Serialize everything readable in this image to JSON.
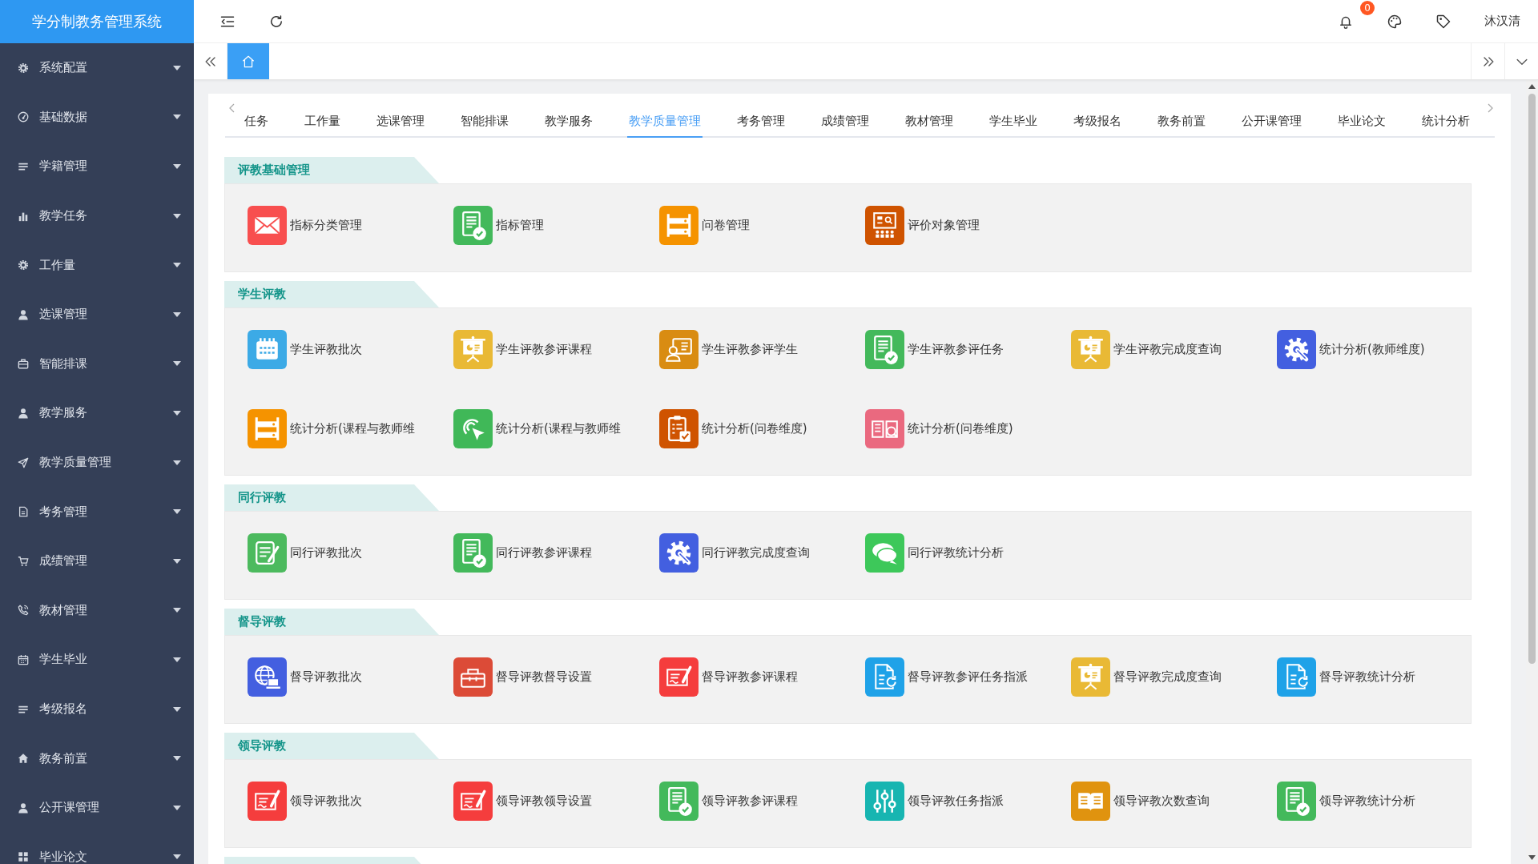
{
  "app": {
    "title": "学分制教务管理系统"
  },
  "sidebar": {
    "items": [
      {
        "label": "系统配置"
      },
      {
        "label": "基础数据"
      },
      {
        "label": "学籍管理"
      },
      {
        "label": "教学任务"
      },
      {
        "label": "工作量"
      },
      {
        "label": "选课管理"
      },
      {
        "label": "智能排课"
      },
      {
        "label": "教学服务"
      },
      {
        "label": "教学质量管理"
      },
      {
        "label": "考务管理"
      },
      {
        "label": "成绩管理"
      },
      {
        "label": "教材管理"
      },
      {
        "label": "学生毕业"
      },
      {
        "label": "考级报名"
      },
      {
        "label": "教务前置"
      },
      {
        "label": "公开课管理"
      },
      {
        "label": "毕业论文"
      }
    ]
  },
  "header": {
    "notification_count": "0",
    "user_name": "沐汉清"
  },
  "page_tabs": [
    {
      "selected": true
    }
  ],
  "content_tabs": [
    {
      "label": "任务",
      "selected": false
    },
    {
      "label": "工作量",
      "selected": false
    },
    {
      "label": "选课管理",
      "selected": false
    },
    {
      "label": "智能排课",
      "selected": false
    },
    {
      "label": "教学服务",
      "selected": false
    },
    {
      "label": "教学质量管理",
      "selected": true
    },
    {
      "label": "考务管理",
      "selected": false
    },
    {
      "label": "成绩管理",
      "selected": false
    },
    {
      "label": "教材管理",
      "selected": false
    },
    {
      "label": "学生毕业",
      "selected": false
    },
    {
      "label": "考级报名",
      "selected": false
    },
    {
      "label": "教务前置",
      "selected": false
    },
    {
      "label": "公开课管理",
      "selected": false
    },
    {
      "label": "毕业论文",
      "selected": false
    },
    {
      "label": "统计分析",
      "selected": false
    }
  ],
  "sections": [
    {
      "kind": "panel",
      "title": "评教基础管理",
      "items": [
        {
          "label": "指标分类管理",
          "color": "#f84f4f"
        },
        {
          "label": "指标管理",
          "color": "#43b95b"
        },
        {
          "label": "问卷管理",
          "color": "#f59300"
        },
        {
          "label": "评价对象管理",
          "color": "#cf5300"
        }
      ]
    },
    {
      "kind": "panel",
      "title": "学生评教",
      "items": [
        {
          "label": "学生评教批次",
          "color": "#3caae6"
        },
        {
          "label": "学生评教参评课程",
          "color": "#e9b935"
        },
        {
          "label": "学生评教参评学生",
          "color": "#d98c12"
        },
        {
          "label": "学生评教参评任务",
          "color": "#43b95b"
        },
        {
          "label": "学生评教完成度查询",
          "color": "#e9b935"
        },
        {
          "label": "统计分析(教师维度)",
          "color": "#435fe0"
        },
        {
          "label": "统计分析(课程与教师维",
          "color": "#f59300"
        },
        {
          "label": "统计分析(课程与教师维",
          "color": "#40b858"
        },
        {
          "label": "统计分析(问卷维度)",
          "color": "#cf5300"
        },
        {
          "label": "统计分析(问卷维度)",
          "color": "#ea697f"
        }
      ]
    },
    {
      "kind": "panel",
      "title": "同行评教",
      "items": [
        {
          "label": "同行评教批次",
          "color": "#4cba5e"
        },
        {
          "label": "同行评教参评课程",
          "color": "#43b95b"
        },
        {
          "label": "同行评教完成度查询",
          "color": "#435fe0"
        },
        {
          "label": "同行评教统计分析",
          "color": "#3dc85a"
        }
      ]
    },
    {
      "kind": "panel",
      "title": "督导评教",
      "items": [
        {
          "label": "督导评教批次",
          "color": "#435fe0"
        },
        {
          "label": "督导评教督导设置",
          "color": "#dc4b37"
        },
        {
          "label": "督导评教参评课程",
          "color": "#f53d3d"
        },
        {
          "label": "督导评教参评任务指派",
          "color": "#1fa2e8"
        },
        {
          "label": "督导评教完成度查询",
          "color": "#e9b935"
        },
        {
          "label": "督导评教统计分析",
          "color": "#1fa2e8"
        }
      ]
    },
    {
      "kind": "panel",
      "title": "领导评教",
      "items": [
        {
          "label": "领导评教批次",
          "color": "#f53d3d"
        },
        {
          "label": "领导评教领导设置",
          "color": "#f53d3d"
        },
        {
          "label": "领导评教参评课程",
          "color": "#43b95b"
        },
        {
          "label": "领导评教任务指派",
          "color": "#17b5b1"
        },
        {
          "label": "领导评教次数查询",
          "color": "#e0930f"
        },
        {
          "label": "领导评教统计分析",
          "color": "#43b95b"
        }
      ]
    },
    {
      "kind": "cut"
    }
  ]
}
